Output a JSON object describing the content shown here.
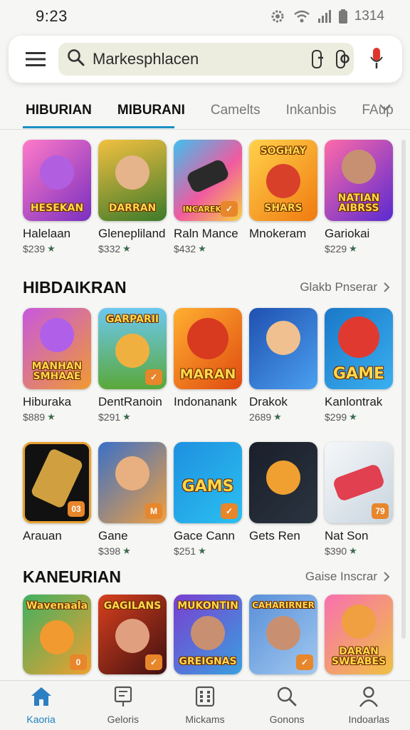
{
  "status_bar": {
    "time": "9:23",
    "battery_text": "1314"
  },
  "search": {
    "value": "Markesphlacen",
    "placeholder": "Markesphlacen"
  },
  "tabs": [
    {
      "label": "HIBURIAN"
    },
    {
      "label": "MIBURANI"
    },
    {
      "label": "Camelts"
    },
    {
      "label": "Inkanbis"
    },
    {
      "label": "FAup"
    }
  ],
  "row1": [
    {
      "name": "Halelaan",
      "price": "$239",
      "icon_text": "HESEKAN",
      "bg": "#d64ab4"
    },
    {
      "name": "Glenepliland",
      "price": "$332",
      "icon_text": "DARRAN",
      "bg": "#5a8a2e"
    },
    {
      "name": "Raln Mance",
      "price": "$432",
      "icon_text": "INCAREKAS",
      "bg": "#2a9adf"
    },
    {
      "name": "Mnokeram",
      "price": "",
      "icon_text": "SHARS",
      "top_text": "SOGHAY",
      "bg": "#f0a020"
    },
    {
      "name": "Gariokai",
      "price": "$229",
      "icon_text": "NATIAN AIBRSS",
      "bg": "#7d3fa8"
    }
  ],
  "section2": {
    "title": "HIBDAIKRAN",
    "link": "Glakb Pnserar",
    "row": [
      {
        "name": "Hiburaka",
        "price": "$889",
        "icon_text": "MANHAN SMHAAE",
        "bg": "#b040c8"
      },
      {
        "name": "DentRanoin",
        "price": "$291",
        "icon_text": "",
        "top_text": "GARPARII",
        "bg": "#3eaad6"
      },
      {
        "name": "Indonanank",
        "price": "",
        "icon_text": "MARAN",
        "bg": "#f07a20"
      },
      {
        "name": "Drakok",
        "price": "2689",
        "icon_text": "",
        "bg": "#3055b8"
      },
      {
        "name": "Kanlontrak",
        "price": "$299",
        "icon_text": "GAME",
        "bg": "#1f7fc8"
      }
    ]
  },
  "row3": [
    {
      "name": "Arauan",
      "price": "",
      "icon_text": "",
      "corner": "03",
      "bg": "#1b1b1b"
    },
    {
      "name": "Gane",
      "price": "$398",
      "icon_text": "",
      "corner": "M",
      "bg": "#2e6ac0"
    },
    {
      "name": "Gace Cann",
      "price": "$251",
      "icon_text": "GAMS",
      "bg": "#1d8fd8"
    },
    {
      "name": "Gets Ren",
      "price": "",
      "icon_text": "",
      "bg": "#14181f"
    },
    {
      "name": "Nat Son",
      "price": "$390",
      "icon_text": "",
      "corner": "79",
      "bg": "#e9eef2"
    }
  ],
  "section4": {
    "title": "KANEURIAN",
    "link": "Gaise Inscrar",
    "row": [
      {
        "icon_text": "",
        "top_text": "Wavenaala",
        "corner": "0",
        "bg": "#3ea85a"
      },
      {
        "icon_text": "",
        "top_text": "GAGILANS",
        "bg": "#c8361e"
      },
      {
        "icon_text": "GREIGNAS",
        "top_text": "MUKONTIN",
        "bg": "#6a3dc0"
      },
      {
        "icon_text": "",
        "top_text": "CAHARIRNER",
        "bg": "#4c88d0"
      },
      {
        "icon_text": "DARAN SWEABES",
        "bg": "#d84a8c"
      }
    ]
  },
  "bottom_nav": [
    {
      "label": "Kaoria"
    },
    {
      "label": "Geloris"
    },
    {
      "label": "Mickams"
    },
    {
      "label": "Gonons"
    },
    {
      "label": "Indoarlas"
    }
  ],
  "colors": {
    "accent": "#1a8fc4",
    "star": "#3d6b4f",
    "mic": "#e0352b"
  }
}
